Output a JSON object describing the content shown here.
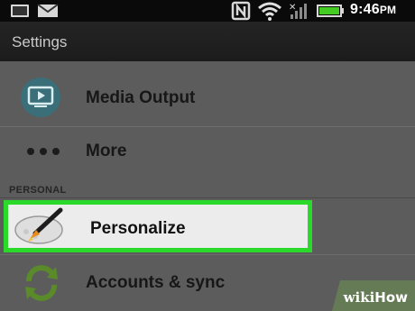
{
  "status_bar": {
    "time": "9:46",
    "ampm": "PM",
    "icons": [
      "picture-icon",
      "gmail-icon",
      "nfc-icon",
      "wifi-icon",
      "no-signal-icon",
      "battery-icon"
    ]
  },
  "action_bar": {
    "title": "Settings"
  },
  "list": {
    "items": [
      {
        "label": "Media Output",
        "icon": "media-output-icon"
      },
      {
        "label": "More",
        "icon": "more-dots-icon"
      }
    ],
    "section_header": "PERSONAL",
    "highlighted_item": {
      "label": "Personalize",
      "icon": "paint-brush-palette-icon"
    },
    "after_items": [
      {
        "label": "Accounts & sync",
        "icon": "sync-icon"
      }
    ]
  },
  "watermark": {
    "wiki": "wiki",
    "how": "How"
  },
  "colors": {
    "highlight_border": "#2bd92b",
    "status_bar_bg": "#0a0a0a",
    "list_bg": "#5c5c5c"
  }
}
